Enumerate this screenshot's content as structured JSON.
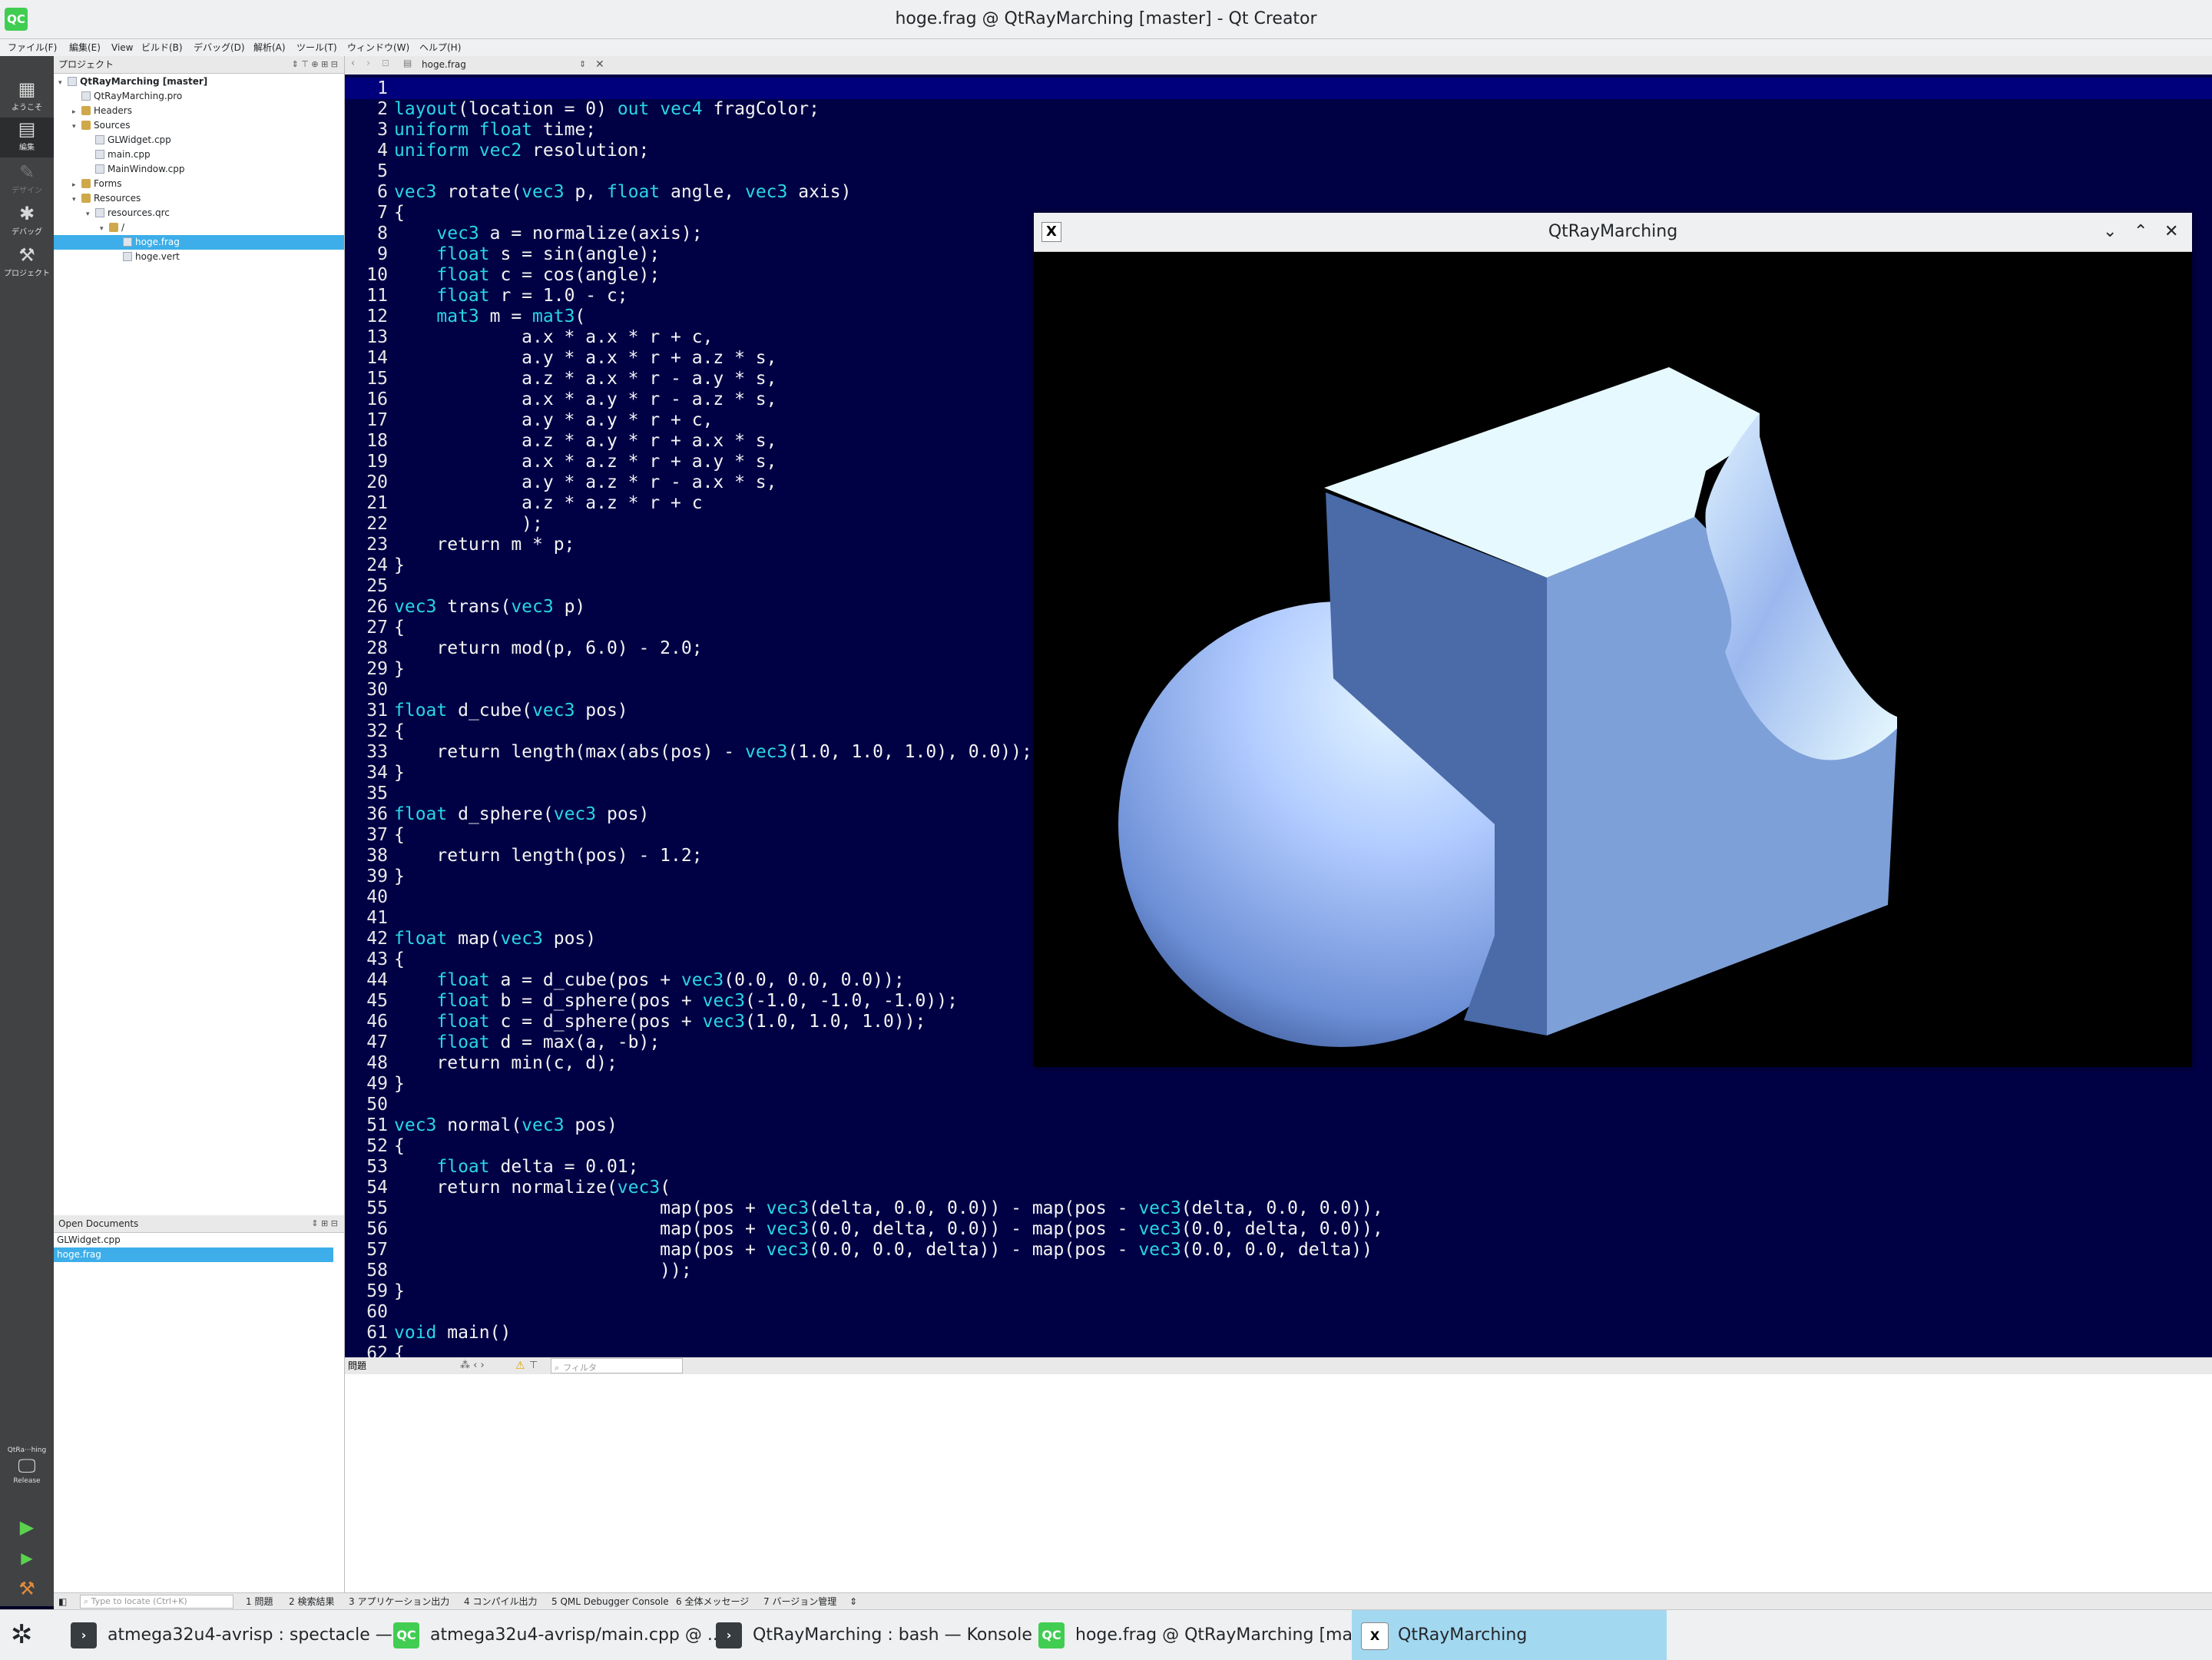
{
  "window": {
    "title": "hoge.frag @ QtRayMarching [master] - Qt Creator",
    "logo": "QC"
  },
  "menu": [
    "ファイル(F)",
    "編集(E)",
    "View",
    "ビルド(B)",
    "デバッグ(D)",
    "解析(A)",
    "ツール(T)",
    "ウィンドウ(W)",
    "ヘルプ(H)"
  ],
  "modes": {
    "welcome": "ようこそ",
    "edit": "編集",
    "design": "デザイン",
    "debug": "デバッグ",
    "projects": "プロジェクト",
    "kit_name": "QtRa···hing",
    "build_config": "Release"
  },
  "project_panel": {
    "title": "プロジェクト",
    "tree": [
      {
        "label": "QtRayMarching [master]",
        "level": 0,
        "twisty": "▾",
        "icon": "project-icon"
      },
      {
        "label": "QtRayMarching.pro",
        "level": 1,
        "twisty": "",
        "icon": "file-icon"
      },
      {
        "label": "Headers",
        "level": 1,
        "twisty": "▸",
        "icon": "folder-icon"
      },
      {
        "label": "Sources",
        "level": 1,
        "twisty": "▾",
        "icon": "folder-icon"
      },
      {
        "label": "GLWidget.cpp",
        "level": 2,
        "twisty": "",
        "icon": "file-icon"
      },
      {
        "label": "main.cpp",
        "level": 2,
        "twisty": "",
        "icon": "file-icon"
      },
      {
        "label": "MainWindow.cpp",
        "level": 2,
        "twisty": "",
        "icon": "file-icon"
      },
      {
        "label": "Forms",
        "level": 1,
        "twisty": "▸",
        "icon": "folder-icon"
      },
      {
        "label": "Resources",
        "level": 1,
        "twisty": "▾",
        "icon": "folder-icon"
      },
      {
        "label": "resources.qrc",
        "level": 2,
        "twisty": "▾",
        "icon": "file-icon"
      },
      {
        "label": "/",
        "level": 3,
        "twisty": "▾",
        "icon": "folder-icon"
      },
      {
        "label": "hoge.frag",
        "level": 4,
        "twisty": "",
        "icon": "file-icon",
        "selected": true
      },
      {
        "label": "hoge.vert",
        "level": 4,
        "twisty": "",
        "icon": "file-icon"
      }
    ]
  },
  "open_documents": {
    "title": "Open Documents",
    "items": [
      {
        "label": "GLWidget.cpp"
      },
      {
        "label": "hoge.frag",
        "selected": true
      }
    ]
  },
  "editor": {
    "filename": "hoge.frag",
    "lines": [
      "",
      "layout(location = 0) out vec4 fragColor;",
      "uniform float time;",
      "uniform vec2 resolution;",
      "",
      "vec3 rotate(vec3 p, float angle, vec3 axis)",
      "{",
      "    vec3 a = normalize(axis);",
      "    float s = sin(angle);",
      "    float c = cos(angle);",
      "    float r = 1.0 - c;",
      "    mat3 m = mat3(",
      "            a.x * a.x * r + c,",
      "            a.y * a.x * r + a.z * s,",
      "            a.z * a.x * r - a.y * s,",
      "            a.x * a.y * r - a.z * s,",
      "            a.y * a.y * r + c,",
      "            a.z * a.y * r + a.x * s,",
      "            a.x * a.z * r + a.y * s,",
      "            a.y * a.z * r - a.x * s,",
      "            a.z * a.z * r + c",
      "            );",
      "    return m * p;",
      "}",
      "",
      "vec3 trans(vec3 p)",
      "{",
      "    return mod(p, 6.0) - 2.0;",
      "}",
      "",
      "float d_cube(vec3 pos)",
      "{",
      "    return length(max(abs(pos) - vec3(1.0, 1.0, 1.0), 0.0));",
      "}",
      "",
      "float d_sphere(vec3 pos)",
      "{",
      "    return length(pos) - 1.2;",
      "}",
      "",
      "",
      "float map(vec3 pos)",
      "{",
      "    float a = d_cube(pos + vec3(0.0, 0.0, 0.0));",
      "    float b = d_sphere(pos + vec3(-1.0, -1.0, -1.0));",
      "    float c = d_sphere(pos + vec3(1.0, 1.0, 1.0));",
      "    float d = max(a, -b);",
      "    return min(c, d);",
      "}",
      "",
      "vec3 normal(vec3 pos)",
      "{",
      "    float delta = 0.01;",
      "    return normalize(vec3(",
      "                         map(pos + vec3(delta, 0.0, 0.0)) - map(pos - vec3(delta, 0.0, 0.0)),",
      "                         map(pos + vec3(0.0, delta, 0.0)) - map(pos - vec3(0.0, delta, 0.0)),",
      "                         map(pos + vec3(0.0, 0.0, delta)) - map(pos - vec3(0.0, 0.0, delta))",
      "                         ));",
      "}",
      "",
      "void main()",
      "{"
    ]
  },
  "output_pane": {
    "title": "問題",
    "filter_placeholder": "フィルタ"
  },
  "statusbar": {
    "locator_placeholder": "Type to locate (Ctrl+K)",
    "tabs": [
      "1 問題",
      "2 検索結果",
      "3 アプリケーション出力",
      "4 コンパイル出力",
      "5 QML Debugger Console",
      "6 全体メッセージ",
      "7 バージョン管理"
    ]
  },
  "app_window": {
    "title": "QtRayMarching"
  },
  "taskbar": {
    "items": [
      {
        "label": "atmega32u4-avrisp : spectacle — ...",
        "icon": "konsole-icon",
        "active": false
      },
      {
        "label": "atmega32u4-avrisp/main.cpp @ ...",
        "icon": "qtcreator-icon",
        "active": false
      },
      {
        "label": "QtRayMarching : bash — Konsole",
        "icon": "konsole-icon",
        "active": false
      },
      {
        "label": "hoge.frag @ QtRayMarching [ma...",
        "icon": "qtcreator-icon",
        "active": false
      },
      {
        "label": "QtRayMarching",
        "icon": "x11-icon",
        "active": true
      }
    ]
  },
  "colors": {
    "editor_bg": "#000045",
    "keyword": "#29d6e6",
    "current_line": "#00007c",
    "selection": "#3daee9"
  }
}
